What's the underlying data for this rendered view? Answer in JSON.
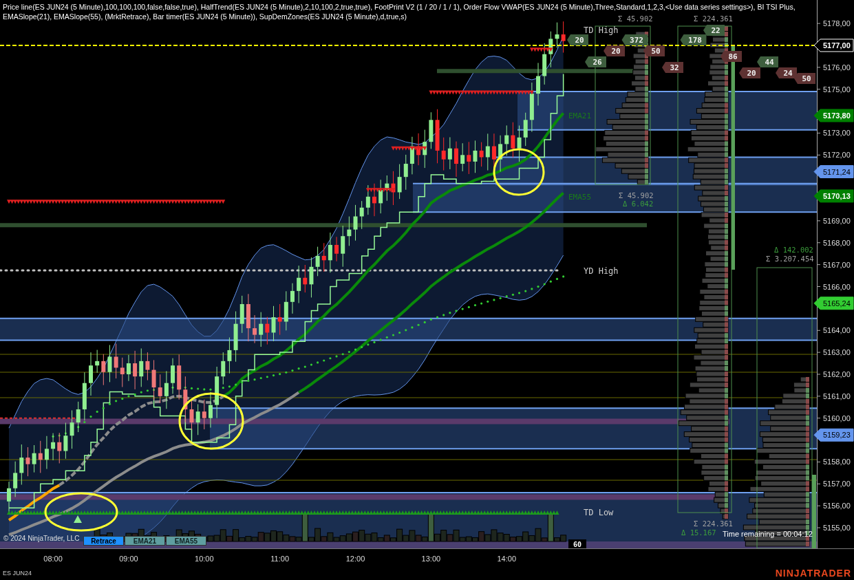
{
  "legend": [
    "Price line(ES JUN24 (5 Minute),100,100,100,false,false,true), HalfTrend(ES JUN24 (5 Minute),2,10,100,2,true,true), FootPrint V2 (1 / 20 / 1 / 1), Order Flow VWAP(ES JUN24 (5 Minute),Three,Standard,1,2,3,<Use data series settings>), BI TSI Plus,",
    "EMASlope(21), EMASlope(55),  (MrktRetrace), Bar timer(ES JUN24 (5 Minute)), SupDemZones(ES JUN24 (5 Minute),d,true,s)"
  ],
  "price_axis": [
    "5178,00",
    "5176,00",
    "5175,00",
    "5173,00",
    "5172,00",
    "5169,00",
    "5168,00",
    "5167,00",
    "5166,00",
    "5164,00",
    "5163,00",
    "5162,00",
    "5161,00",
    "5160,00",
    "5158,00",
    "5157,00",
    "5156,00",
    "5155,00"
  ],
  "time_axis": [
    "08:00",
    "09:00",
    "10:00",
    "11:00",
    "12:00",
    "13:00",
    "14:00"
  ],
  "level_labels": [
    "TD High",
    "YD High",
    "TD Low"
  ],
  "ema_labels": [
    "EMA21",
    "EMA55"
  ],
  "stats": [
    {
      "text": "Σ 45.902",
      "kind": "sum"
    },
    {
      "text": "Σ 224.361",
      "kind": "sum"
    },
    {
      "text": "Σ 45.902",
      "kind": "sum"
    },
    {
      "text": "Δ 6.042",
      "kind": "delta"
    },
    {
      "text": "Δ 142.002",
      "kind": "delta"
    },
    {
      "text": "Σ 3.207.454",
      "kind": "sum"
    },
    {
      "text": "Σ 224.361",
      "kind": "sum"
    },
    {
      "text": "Δ 15.167",
      "kind": "delta"
    }
  ],
  "footprint_badges": [
    {
      "text": "22",
      "kind": "buy"
    },
    {
      "text": "20",
      "kind": "buy"
    },
    {
      "text": "372",
      "kind": "buy"
    },
    {
      "text": "178",
      "kind": "buy"
    },
    {
      "text": "20",
      "kind": "sell"
    },
    {
      "text": "50",
      "kind": "sell"
    },
    {
      "text": "86",
      "kind": "sell"
    },
    {
      "text": "26",
      "kind": "buy"
    },
    {
      "text": "44",
      "kind": "buy"
    },
    {
      "text": "32",
      "kind": "sell"
    },
    {
      "text": "20",
      "kind": "sell"
    },
    {
      "text": "24",
      "kind": "sell"
    },
    {
      "text": "50",
      "kind": "sell"
    }
  ],
  "price_markers": [
    {
      "label": "5177,00",
      "color": "#000000"
    },
    {
      "label": "5173,80",
      "color": "#008000"
    },
    {
      "label": "5171,24",
      "color": "#6495ed"
    },
    {
      "label": "5170,13",
      "color": "#008000"
    },
    {
      "label": "5165,24",
      "color": "#32cd32"
    },
    {
      "label": "5159,23",
      "color": "#6495ed"
    }
  ],
  "copyright": "© 2024 NinjaTrader, LLC",
  "buttons": [
    {
      "label": "Retrace",
      "selected": true
    },
    {
      "label": "EMA21",
      "selected": false
    },
    {
      "label": "EMA55",
      "selected": false
    }
  ],
  "bar_count": "60",
  "time_remaining": "Time remaining = 00:04:12",
  "instrument": "ES JUN24",
  "logo": "NINJATRADER"
}
